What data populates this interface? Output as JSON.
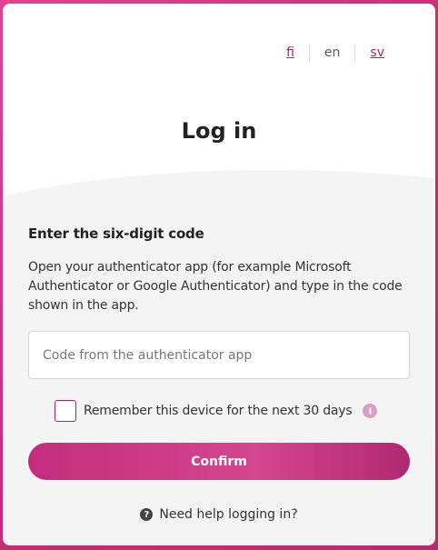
{
  "languages": {
    "fi": "fi",
    "en": "en",
    "sv": "sv"
  },
  "title": "Log in",
  "section_title": "Enter the six-digit code",
  "instructions": "Open your authenticator app (for example Microsoft Authenticator or Google Authenticator) and type in the code shown in the app.",
  "code_input": {
    "placeholder": "Code from the authenticator app",
    "value": ""
  },
  "remember": {
    "label": "Remember this device for the next 30 days",
    "checked": false,
    "info_icon": "i"
  },
  "confirm_label": "Confirm",
  "help": {
    "icon": "?",
    "label": "Need help logging in?"
  },
  "colors": {
    "accent": "#a7246a",
    "button": "#c42d7e",
    "background": "#d63a86"
  }
}
